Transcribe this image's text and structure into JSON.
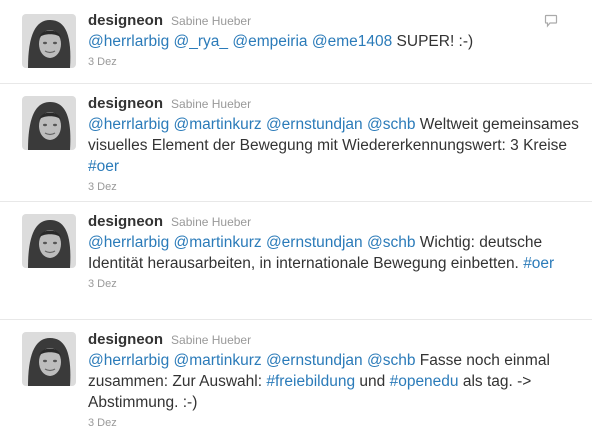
{
  "tweets": [
    {
      "screen_name": "designeon",
      "full_name": "Sabine Hueber",
      "parts": [
        {
          "t": "@herrlarbig",
          "link": true
        },
        {
          "t": " ",
          "link": false
        },
        {
          "t": "@_rya_",
          "link": true
        },
        {
          "t": " ",
          "link": false
        },
        {
          "t": "@empeiria",
          "link": true
        },
        {
          "t": " ",
          "link": false
        },
        {
          "t": "@eme1408",
          "link": true
        },
        {
          "t": " SUPER! :-)",
          "link": false
        }
      ],
      "timestamp": "3 Dez",
      "show_reply_icon": true
    },
    {
      "screen_name": "designeon",
      "full_name": "Sabine Hueber",
      "parts": [
        {
          "t": "@herrlarbig",
          "link": true
        },
        {
          "t": " ",
          "link": false
        },
        {
          "t": "@martinkurz",
          "link": true
        },
        {
          "t": " ",
          "link": false
        },
        {
          "t": "@ernstundjan",
          "link": true
        },
        {
          "t": " ",
          "link": false
        },
        {
          "t": "@schb",
          "link": true
        },
        {
          "t": " Weltweit gemeinsames visuelles Element der Bewegung mit Wiedererkennungswert: 3 Kreise ",
          "link": false
        },
        {
          "t": "#oer",
          "link": true
        }
      ],
      "timestamp": "3 Dez",
      "show_reply_icon": false
    },
    {
      "screen_name": "designeon",
      "full_name": "Sabine Hueber",
      "parts": [
        {
          "t": "@herrlarbig",
          "link": true
        },
        {
          "t": " ",
          "link": false
        },
        {
          "t": "@martinkurz",
          "link": true
        },
        {
          "t": " ",
          "link": false
        },
        {
          "t": "@ernstundjan",
          "link": true
        },
        {
          "t": " ",
          "link": false
        },
        {
          "t": "@schb",
          "link": true
        },
        {
          "t": " Wichtig: deutsche Identität herausarbeiten, in internationale Bewegung einbetten. ",
          "link": false
        },
        {
          "t": "#oer",
          "link": true
        }
      ],
      "timestamp": "3 Dez",
      "show_reply_icon": false
    },
    {
      "screen_name": "designeon",
      "full_name": "Sabine Hueber",
      "parts": [
        {
          "t": "@herrlarbig",
          "link": true
        },
        {
          "t": " ",
          "link": false
        },
        {
          "t": "@martinkurz",
          "link": true
        },
        {
          "t": " ",
          "link": false
        },
        {
          "t": "@ernstundjan",
          "link": true
        },
        {
          "t": " ",
          "link": false
        },
        {
          "t": "@schb",
          "link": true
        },
        {
          "t": " Fasse noch einmal zusammen: Zur Auswahl: ",
          "link": false
        },
        {
          "t": "#freiebildung",
          "link": true
        },
        {
          "t": " und ",
          "link": false
        },
        {
          "t": "#openedu",
          "link": true
        },
        {
          "t": " als tag. -> Abstimmung. :-)",
          "link": false
        }
      ],
      "timestamp": "3 Dez",
      "show_reply_icon": false
    }
  ],
  "colors": {
    "link": "#2b7bb9",
    "meta": "#999999",
    "text": "#333333"
  },
  "icons": {
    "reply": "speech-bubble-icon",
    "avatar": "profile-photo"
  }
}
